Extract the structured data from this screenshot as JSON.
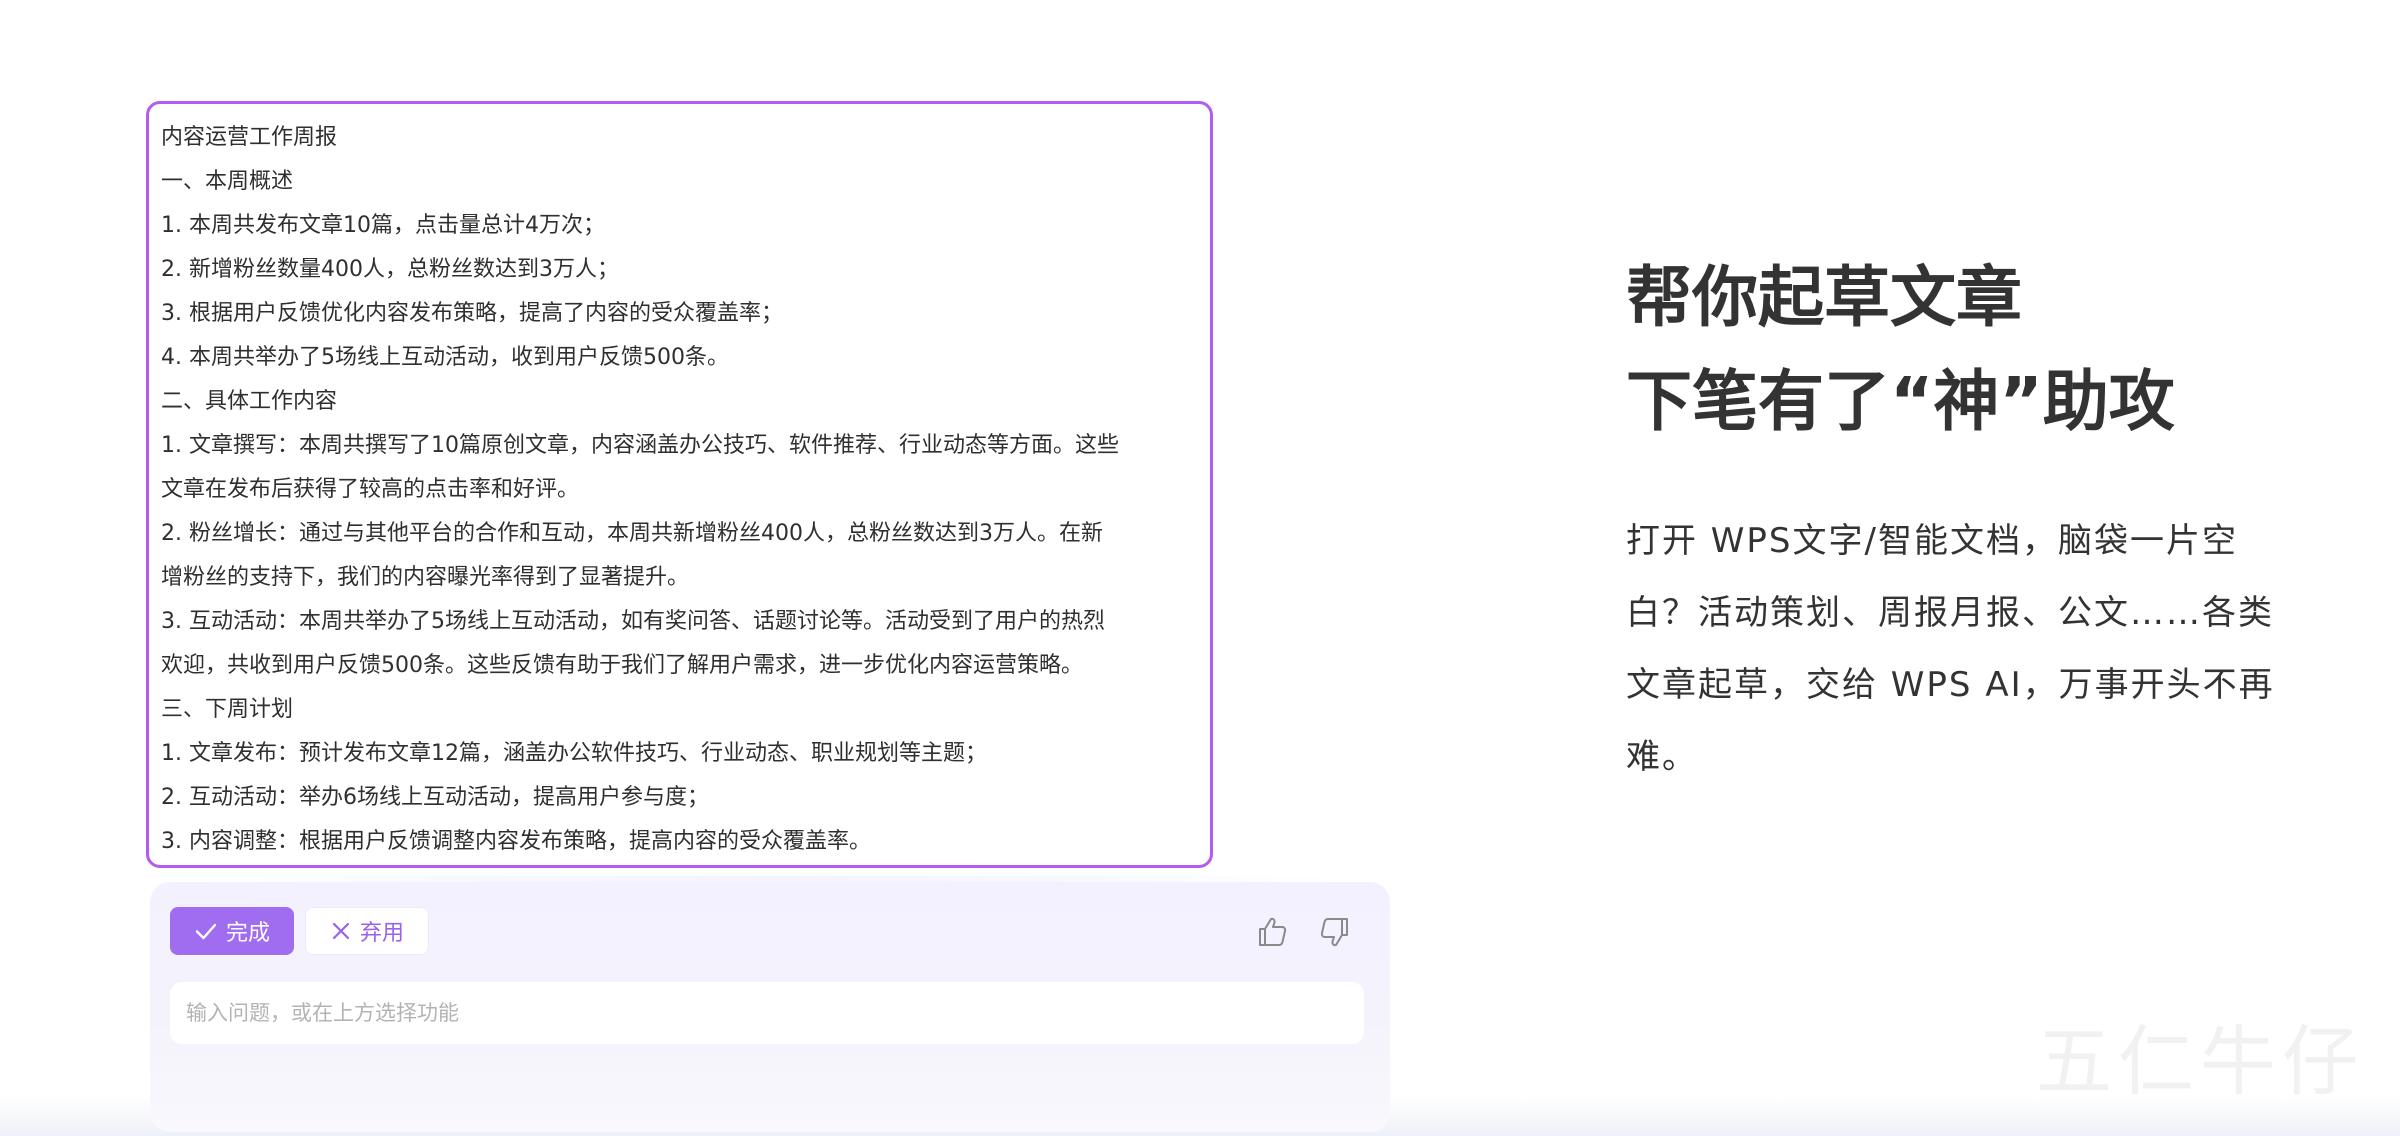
{
  "document": {
    "lines": [
      "内容运营工作周报",
      "一、本周概述",
      "1. 本周共发布文章10篇，点击量总计4万次；",
      "2. 新增粉丝数量400人，总粉丝数达到3万人；",
      "3. 根据用户反馈优化内容发布策略，提高了内容的受众覆盖率；",
      "4. 本周共举办了5场线上互动活动，收到用户反馈500条。",
      "二、具体工作内容",
      "1. 文章撰写：本周共撰写了10篇原创文章，内容涵盖办公技巧、软件推荐、行业动态等方面。这些",
      "文章在发布后获得了较高的点击率和好评。",
      "2. 粉丝增长：通过与其他平台的合作和互动，本周共新增粉丝400人，总粉丝数达到3万人。在新",
      "增粉丝的支持下，我们的内容曝光率得到了显著提升。",
      "3. 互动活动：本周共举办了5场线上互动活动，如有奖问答、话题讨论等。活动受到了用户的热烈",
      "欢迎，共收到用户反馈500条。这些反馈有助于我们了解用户需求，进一步优化内容运营策略。",
      "三、下周计划",
      "1. 文章发布：预计发布文章12篇，涵盖办公软件技巧、行业动态、职业规划等主题；",
      "2. 互动活动：举办6场线上互动活动，提高用户参与度；",
      "3. 内容调整：根据用户反馈调整内容发布策略，提高内容的受众覆盖率。"
    ]
  },
  "ai_panel": {
    "done_label": "完成",
    "discard_label": "弃用",
    "input_placeholder": "输入问题，或在上方选择功能"
  },
  "promo": {
    "headline_line1": "帮你起草文章",
    "headline_line2": "下笔有了“神”助攻",
    "description": "打开 WPS文字/智能文档，脑袋一片空白？活动策划、周报月报、公文……各类文章起草，交给 WPS AI，万事开头不再难。"
  },
  "watermark_text": "五仁牛仔",
  "colors": {
    "accent": "#a06cf0",
    "border": "#b45cf0",
    "text": "#333333"
  }
}
